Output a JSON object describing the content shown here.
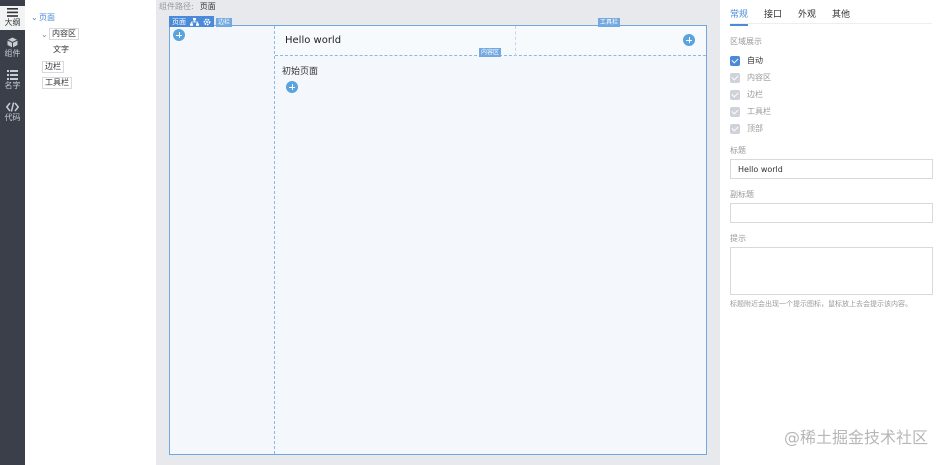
{
  "rail": {
    "items": [
      {
        "label": "大纲",
        "icon": "menu-icon"
      },
      {
        "label": "组件",
        "icon": "cube-icon"
      },
      {
        "label": "名字",
        "icon": "list-icon"
      },
      {
        "label": "代码",
        "icon": "code-icon"
      }
    ]
  },
  "tree": {
    "root": "页面",
    "content": "内容区",
    "text": "文字",
    "aside": "边栏",
    "toolbar": "工具栏"
  },
  "breadcrumb": {
    "label": "组件路径:",
    "current": "页面"
  },
  "canvas": {
    "page_tag": "页面",
    "aside_tag": "边栏",
    "toolbar_tag": "工具栏",
    "content_tag": "内容区",
    "header_title": "Hello world",
    "body_text": "初始页面"
  },
  "panel": {
    "tabs": [
      {
        "label": "常规",
        "active": true
      },
      {
        "label": "接口",
        "active": false
      },
      {
        "label": "外观",
        "active": false
      },
      {
        "label": "其他",
        "active": false
      }
    ],
    "region_label": "区域展示",
    "regions": [
      {
        "label": "自动",
        "checked": true
      },
      {
        "label": "内容区",
        "checked": false
      },
      {
        "label": "边栏",
        "checked": false
      },
      {
        "label": "工具栏",
        "checked": false
      },
      {
        "label": "顶部",
        "checked": false
      }
    ],
    "title_label": "标题",
    "title_value": "Hello world",
    "subtitle_label": "副标题",
    "subtitle_value": "",
    "remark_label": "提示",
    "remark_value": "",
    "hint": "标题附近会出现一个提示图标，鼠标放上去会提示该内容。"
  },
  "watermark": "@稀土掘金技术社区",
  "colors": {
    "accent": "#4a8ad9",
    "rail": "#3a3f4a",
    "canvas_bg": "#e8e9ec",
    "page_bg": "#f4f8fd"
  }
}
